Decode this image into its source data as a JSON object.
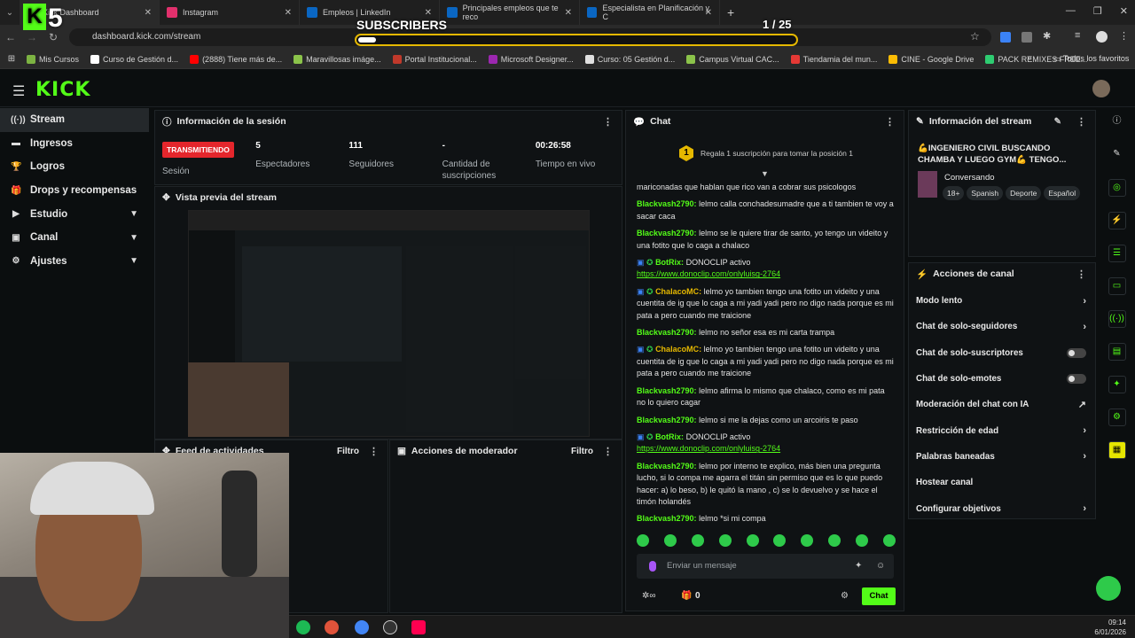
{
  "browser": {
    "tabs": [
      {
        "label": "Kick Dashboard",
        "color": "#53fc18"
      },
      {
        "label": "Instagram",
        "color": "#e1306c"
      },
      {
        "label": "Empleos | LinkedIn",
        "color": "#0a66c2"
      },
      {
        "label": "Principales empleos que te reco",
        "color": "#0a66c2"
      },
      {
        "label": "Especialista en Planificación y C",
        "color": "#0a66c2"
      }
    ],
    "new_tab": "+",
    "url": "dashboard.kick.com/stream",
    "bookmarks": [
      {
        "label": "Mis Cursos",
        "color": "#7cb342"
      },
      {
        "label": "Curso de Gestión d...",
        "color": "#ffffff"
      },
      {
        "label": "(2888) Tiene más de...",
        "color": "#ff0000"
      },
      {
        "label": "Maravillosas imáge...",
        "color": "#8bc34a"
      },
      {
        "label": "Portal Institucional...",
        "color": "#c0392b"
      },
      {
        "label": "Microsoft Designer...",
        "color": "#9c27b0"
      },
      {
        "label": "Curso: 05 Gestión d...",
        "color": "#e0e0e0"
      },
      {
        "label": "Campus Virtual CAC...",
        "color": "#8bc34a"
      },
      {
        "label": "Tiendamia del mun...",
        "color": "#e53935"
      },
      {
        "label": "CINE - Google Drive",
        "color": "#fbbc04"
      },
      {
        "label": "PACK REMIXES FREE...",
        "color": "#2ecc71"
      }
    ],
    "all_favorites": "Todos los favoritos"
  },
  "overlay": {
    "logo_number": "5",
    "subscribers_title": "SUBSCRIBERS",
    "subscribers_count": "1 / 25",
    "progress": 0.04
  },
  "header": {
    "logo": "KICK"
  },
  "sidebar": {
    "items": [
      {
        "label": "Stream",
        "icon": "stream-icon",
        "glyph": "((·))"
      },
      {
        "label": "Ingresos",
        "icon": "money-icon",
        "glyph": "▬"
      },
      {
        "label": "Logros",
        "icon": "trophy-icon",
        "glyph": "🏆"
      },
      {
        "label": "Drops y recompensas",
        "icon": "gift-icon",
        "glyph": "🎁"
      },
      {
        "label": "Estudio",
        "icon": "camera-icon",
        "glyph": "▶"
      },
      {
        "label": "Canal",
        "icon": "channel-icon",
        "glyph": "▣"
      },
      {
        "label": "Ajustes",
        "icon": "settings-icon",
        "glyph": "⚙"
      }
    ]
  },
  "session": {
    "title": "Información de la sesión",
    "live_badge": "TRANSMITIENDO",
    "stats": [
      {
        "value": "",
        "label": "Sesión"
      },
      {
        "value": "5",
        "label": "Espectadores"
      },
      {
        "value": "111",
        "label": "Seguidores"
      },
      {
        "value": "-",
        "label": "Cantidad de suscripciones"
      },
      {
        "value": "00:26:58",
        "label": "Tiempo en vivo"
      }
    ]
  },
  "preview": {
    "title": "Vista previa del stream"
  },
  "activity_feed": {
    "title": "Feed de actividades",
    "filter": "Filtro"
  },
  "mod_actions": {
    "title": "Acciones de moderador",
    "filter": "Filtro"
  },
  "chat": {
    "title": "Chat",
    "pinned_count": "1",
    "pinned_text": "Regala 1 suscripción para tomar la posición 1",
    "messages": [
      {
        "user": "",
        "color": "#e3e3e3",
        "text": "mariconadas que hablan que rico van a cobrar sus psicologos",
        "link": ""
      },
      {
        "user": "Blackvash2790:",
        "color": "#53fc18",
        "text": "lelmo calla conchadesumadre que a ti tambien te voy a sacar caca",
        "link": ""
      },
      {
        "user": "Blackvash2790:",
        "color": "#53fc18",
        "text": "lelmo se le quiere tirar de santo, yo tengo un videito y una fotito que lo caga a chalaco",
        "link": ""
      },
      {
        "user": "BotRix:",
        "color": "#53fc18",
        "text": "DONOCLIP activo",
        "link": "https://www.donoclip.com/onlyluisg-2764"
      },
      {
        "user": "ChalacoMC:",
        "color": "#e5b800",
        "text": "lelmo yo tambien tengo una fotito un videito y una cuentita de ig que lo caga a mi yadi yadi pero no digo nada porque es mi pata a pero cuando me traicione",
        "link": ""
      },
      {
        "user": "Blackvash2790:",
        "color": "#53fc18",
        "text": "lelmo no señor esa es mi carta trampa",
        "link": ""
      },
      {
        "user": "ChalacoMC:",
        "color": "#e5b800",
        "text": "lelmo yo tambien tengo una fotito un videito y una cuentita de ig que lo caga a mi yadi yadi pero no digo nada porque es mi pata a pero cuando me traicione",
        "link": ""
      },
      {
        "user": "Blackvash2790:",
        "color": "#53fc18",
        "text": "lelmo afirma lo mismo que chalaco, como es mi pata no lo quiero cagar",
        "link": ""
      },
      {
        "user": "Blackvash2790:",
        "color": "#53fc18",
        "text": "lelmo si me la dejas como un arcoiris te paso",
        "link": ""
      },
      {
        "user": "BotRix:",
        "color": "#53fc18",
        "text": "DONOCLIP activo",
        "link": "https://www.donoclip.com/onlyluisg-2764"
      },
      {
        "user": "Blackvash2790:",
        "color": "#53fc18",
        "text": "lelmo por interno te explico, más bien una pregunta lucho, si lo compa me agarra el titán sin permiso que es lo que puedo hacer: a) lo beso, b) le quitó la mano , c) se lo devuelvo y se hace el timón holandés",
        "link": ""
      },
      {
        "user": "Blackvash2790:",
        "color": "#53fc18",
        "text": "lelmo *si mi compa",
        "link": ""
      }
    ],
    "input_placeholder": "Enviar un mensaje",
    "points": "0",
    "send_label": "Chat"
  },
  "stream_info": {
    "title": "Información del stream",
    "stream_title": "💪INGENIERO CIVIL BUSCANDO CHAMBA Y LUEGO GYM💪 TENGO...",
    "category": "Conversando",
    "tags": [
      "18+",
      "Spanish",
      "Deporte",
      "Español"
    ]
  },
  "channel_actions": {
    "title": "Acciones de canal",
    "items": [
      {
        "label": "Modo lento",
        "control": "chevron"
      },
      {
        "label": "Chat de solo-seguidores",
        "control": "chevron"
      },
      {
        "label": "Chat de solo-suscriptores",
        "control": "toggle"
      },
      {
        "label": "Chat de solo-emotes",
        "control": "toggle"
      },
      {
        "label": "Moderación del chat con IA",
        "control": "external"
      },
      {
        "label": "Restricción de edad",
        "control": "chevron"
      },
      {
        "label": "Palabras baneadas",
        "control": "chevron"
      },
      {
        "label": "Hostear canal",
        "control": "none"
      },
      {
        "label": "Configurar objetivos",
        "control": "chevron"
      }
    ]
  },
  "taskbar": {
    "time": "09:14",
    "date": "6/01/2026"
  },
  "colors": {
    "accent": "#53fc18",
    "live": "#e4262c",
    "gold": "#e5b800"
  }
}
